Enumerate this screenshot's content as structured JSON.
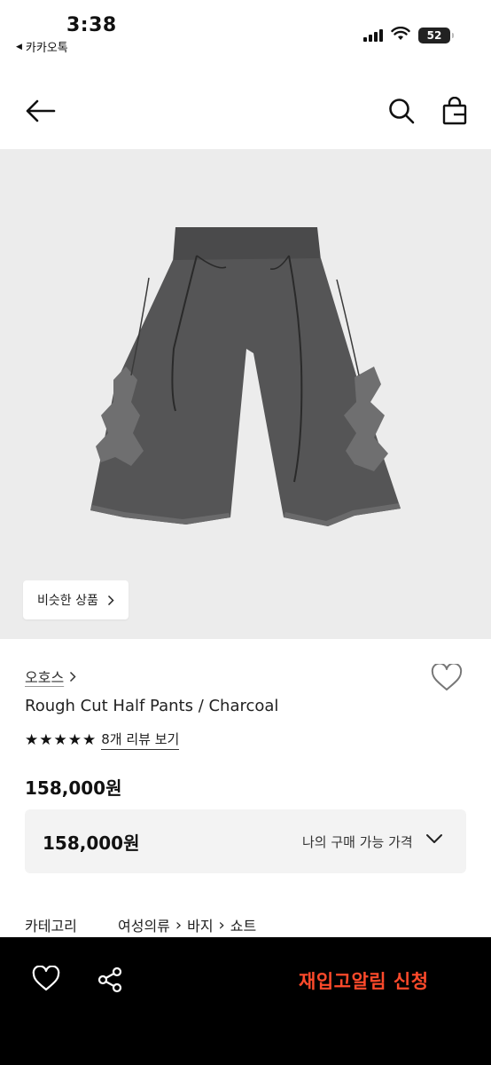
{
  "status_bar": {
    "time": "3:38",
    "back_app": "카카오톡",
    "battery": "52"
  },
  "nav": {
    "back_icon": "arrow-left-icon",
    "search_icon": "search-icon",
    "bag_icon": "shopping-bag-icon"
  },
  "hero": {
    "image": "charcoal-shorts-photo",
    "similar_button": "비슷한 상품"
  },
  "product": {
    "brand": "오호스",
    "title": "Rough Cut Half Pants / Charcoal",
    "rating_stars": 5,
    "review_link": "8개 리뷰 보기",
    "price": "158,000원"
  },
  "my_price": {
    "value": "158,000원",
    "label": "나의 구매 가능 가격"
  },
  "category": {
    "label": "카테고리",
    "path": [
      "여성의류",
      "바지",
      "쇼트"
    ]
  },
  "bottom_bar": {
    "restock_label": "재입고알림 신청"
  },
  "colors": {
    "accent": "#ff4a2b",
    "hero_bg": "#ececec",
    "bottom_bar_bg": "#000000"
  }
}
